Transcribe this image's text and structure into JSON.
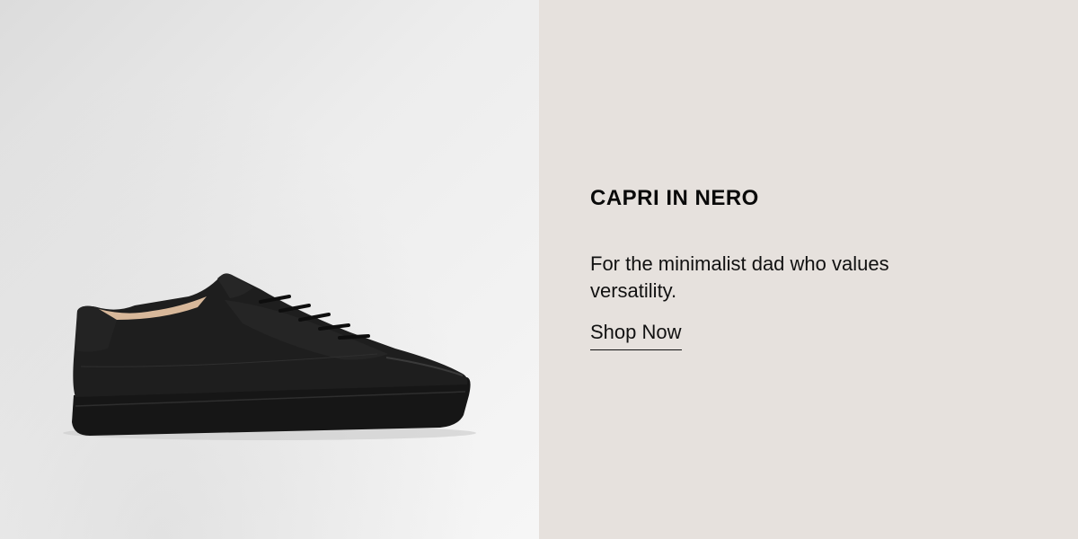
{
  "product": {
    "title": "CAPRI IN NERO",
    "description": "For the minimalist dad who values versatility.",
    "cta_label": "Shop Now",
    "image_alt": "Black leather low-top sneaker"
  },
  "colors": {
    "text_panel_bg": "#e6e1dd",
    "text": "#0a0a0a",
    "shoe": "#1a1a1a"
  }
}
